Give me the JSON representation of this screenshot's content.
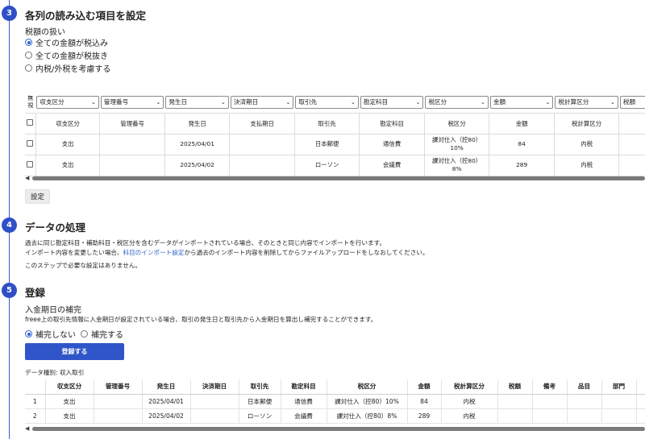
{
  "step3": {
    "number": "3",
    "title": "各列の読み込む項目を設定",
    "tax_label": "税額の扱い",
    "options": [
      "全ての金額が税込み",
      "全ての金額が税抜き",
      "内税/外税を考慮する"
    ],
    "selected_option": 0,
    "ignore_header_line1": "無",
    "ignore_header_line2": "視",
    "dropdowns": [
      "収支区分",
      "管理番号",
      "発生日",
      "決済期日",
      "取引先",
      "勘定科目",
      "税区分",
      "金額",
      "税計算区分",
      "税額"
    ],
    "headers": [
      "収支区分",
      "管理番号",
      "発生日",
      "支払期日",
      "取引先",
      "勘定科目",
      "税区分",
      "金額",
      "税計算区分",
      "税額"
    ],
    "rows": [
      {
        "cells": [
          "支出",
          "",
          "2025/04/01",
          "",
          "日本郵便",
          "通信費",
          "課対仕入（控80）\n10%",
          "84",
          "内税",
          ""
        ]
      },
      {
        "cells": [
          "支出",
          "",
          "2025/04/02",
          "",
          "ローソン",
          "会議費",
          "課対仕入（控80）\n8%",
          "289",
          "内税",
          ""
        ]
      }
    ],
    "settings_button": "設定"
  },
  "step4": {
    "number": "4",
    "title": "データの処理",
    "line1": "過去に同じ勘定科目・補助科目・税区分を含むデータがインポートされている場合、そのときと同じ内容でインポートを行います。",
    "line2_prefix": "インポート内容を変更したい場合、",
    "line2_link": "科目のインポート設定",
    "line2_suffix": "から過去のインポート内容を削除してからファイルアップロードをしなおしてください。",
    "line3": "このステップで必要な設定はありません。"
  },
  "step5": {
    "number": "5",
    "title": "登録",
    "sub_title": "入金期日の補完",
    "description": "freee上の取引先情報に入金期日が設定されている場合、取引の発生日と取引先から入金期日を算出し補完することができます。",
    "options": [
      "補完しない",
      "補完する"
    ],
    "selected_option": 0,
    "register_button": "登録する",
    "data_type": "データ種別: 収入取引",
    "headers": [
      "",
      "収支区分",
      "管理番号",
      "発生日",
      "決済期日",
      "取引先",
      "勘定科目",
      "税区分",
      "金額",
      "税計算区分",
      "税額",
      "備考",
      "品目",
      "部門"
    ],
    "rows": [
      {
        "cells": [
          "1",
          "支出",
          "",
          "2025/04/01",
          "",
          "日本郵便",
          "通信費",
          "課対仕入（控80）10%",
          "84",
          "内税",
          "",
          "",
          "",
          ""
        ]
      },
      {
        "cells": [
          "2",
          "支出",
          "",
          "2025/04/02",
          "",
          "ローソン",
          "会議費",
          "課対仕入（控80）8%",
          "289",
          "内税",
          "",
          "",
          "",
          ""
        ]
      }
    ]
  },
  "colors": {
    "accent": "#2e4fc7",
    "link": "#2f62c9"
  }
}
